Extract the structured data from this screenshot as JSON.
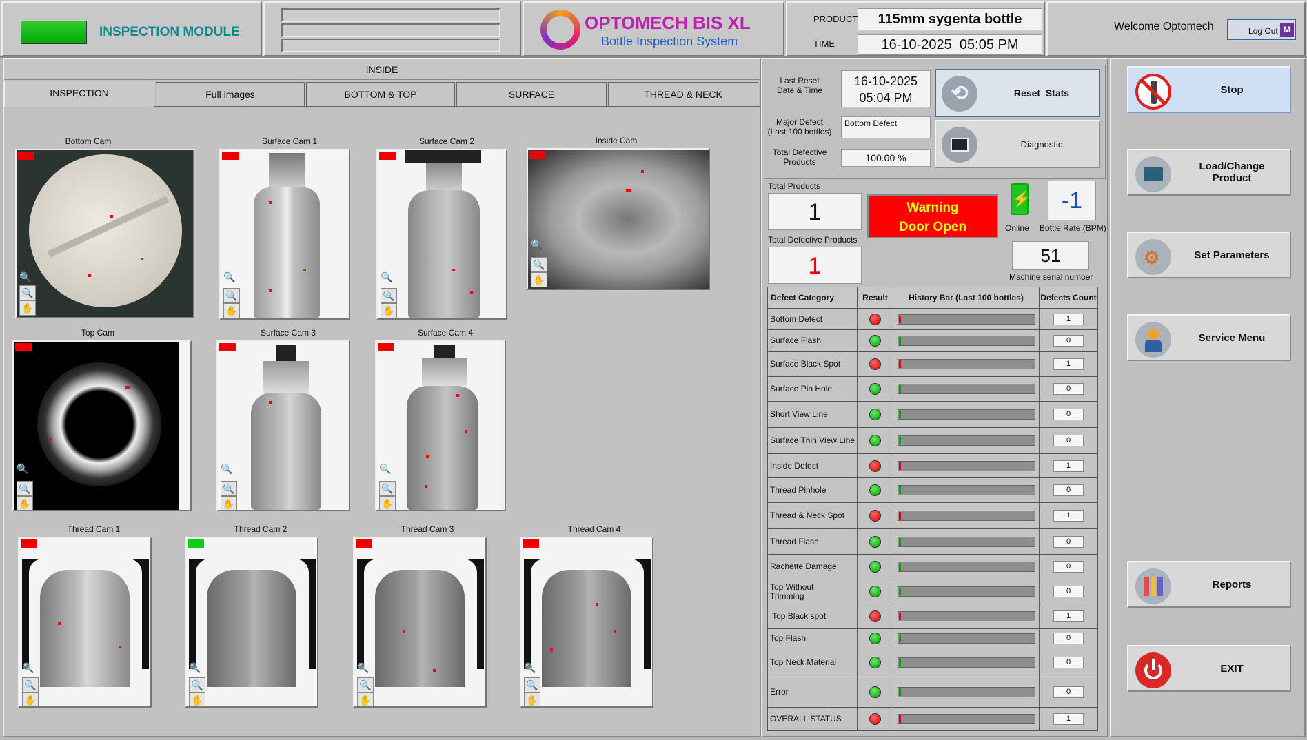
{
  "header": {
    "module_title": "INSPECTION MODULE",
    "brand_name": "OPTOMECH BIS XL",
    "brand_subtitle": "Bottle Inspection System",
    "product_label": "PRODUCT",
    "product_value": "115mm sygenta bottle",
    "time_label": "TIME",
    "time_value": "16-10-2025  05:05 PM",
    "welcome": "Welcome Optomech",
    "logout_label": "Log Out",
    "logout_badge": "M"
  },
  "section_label": "INSIDE",
  "tabs": [
    {
      "label": "INSPECTION",
      "active": true
    },
    {
      "label": "Full images"
    },
    {
      "label": "BOTTOM & TOP"
    },
    {
      "label": "SURFACE"
    },
    {
      "label": "THREAD & NECK"
    }
  ],
  "cameras": [
    {
      "name": "Bottom Cam",
      "status": "red"
    },
    {
      "name": "Surface Cam 1",
      "status": "red"
    },
    {
      "name": "Surface Cam 2",
      "status": "red"
    },
    {
      "name": "Inside Cam",
      "status": "red"
    },
    {
      "name": "Top Cam",
      "status": "red"
    },
    {
      "name": "Surface Cam 3",
      "status": "red"
    },
    {
      "name": "Surface Cam 4",
      "status": "red"
    },
    {
      "name": "Thread Cam 1",
      "status": "red"
    },
    {
      "name": "Thread Cam 2",
      "status": "green"
    },
    {
      "name": "Thread Cam 3",
      "status": "red"
    },
    {
      "name": "Thread Cam 4",
      "status": "red"
    }
  ],
  "stats": {
    "last_reset_label": "Last Reset\nDate & Time",
    "last_reset_date": "16-10-2025",
    "last_reset_time": "05:04 PM",
    "major_defect_label": "Major Defect\n(Last 100 bottles)",
    "major_defect_value": "Bottom Defect",
    "total_defective_label": "Total Defective\nProducts",
    "total_defective_pct": "100.00 %",
    "reset_button": "Reset  Stats",
    "diagnostic_button": "Diagnostic",
    "total_products_label": "Total Products",
    "total_products": "1",
    "total_defective_products_label": "Total Defective Products",
    "total_defective_products": "1",
    "warning_line1": "Warning",
    "warning_line2": "Door Open",
    "online_label": "Online",
    "bottle_rate_label": "Bottle Rate (BPM)",
    "bottle_rate": "-1",
    "machine_serial": "51",
    "machine_serial_label": "Machine serial number"
  },
  "defect_table": {
    "headers": [
      "Defect Category",
      "Result",
      "History Bar (Last 100 bottles)",
      "Defects Count"
    ],
    "rows": [
      {
        "category": "Bottom Defect",
        "result": "red",
        "count": "1"
      },
      {
        "category": "Surface Flash",
        "result": "green",
        "count": "0"
      },
      {
        "category": "Surface Black Spot",
        "result": "red",
        "count": "1"
      },
      {
        "category": "Surface Pin Hole",
        "result": "green",
        "count": "0"
      },
      {
        "category": "Short View Line",
        "result": "green",
        "count": "0"
      },
      {
        "category": "Surface Thin View Line",
        "result": "green",
        "count": "0"
      },
      {
        "category": "Inside Defect",
        "result": "red",
        "count": "1"
      },
      {
        "category": "Thread Pinhole",
        "result": "green",
        "count": "0"
      },
      {
        "category": "Thread & Neck Spot",
        "result": "red",
        "count": "1"
      },
      {
        "category": "Thread Flash",
        "result": "green",
        "count": "0"
      },
      {
        "category": "Rachette Damage",
        "result": "green",
        "count": "0"
      },
      {
        "category": "Top Without\nTrimming",
        "result": "green",
        "count": "0"
      },
      {
        "category": " Top Black spot",
        "result": "red",
        "count": "1"
      },
      {
        "category": "Top Flash",
        "result": "green",
        "count": "0"
      },
      {
        "category": "Top Neck Material",
        "result": "green",
        "count": "0"
      },
      {
        "category": "Error",
        "result": "green",
        "count": "0"
      },
      {
        "category": "OVERALL STATUS",
        "result": "red",
        "count": "1"
      }
    ]
  },
  "menu": {
    "stop": "Stop",
    "load_change": "Load/Change\nProduct",
    "set_parameters": "Set Parameters",
    "service_menu": "Service Menu",
    "reports": "Reports",
    "exit": "EXIT"
  },
  "colors": {
    "defect_red": "#e00000",
    "ok_green": "#00a000",
    "brand_magenta": "#c020b0",
    "brand_blue": "#2060c0",
    "module_teal": "#0a8a8a",
    "warning_bg": "#ff0000",
    "warning_text": "#ffff00"
  }
}
